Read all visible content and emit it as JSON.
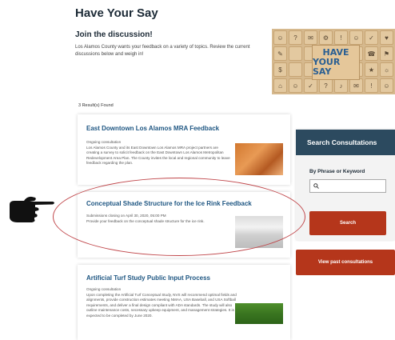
{
  "page": {
    "title": "Have Your Say",
    "join_heading": "Join the discussion!",
    "join_text": "Los Alamos County wants your feedback on a variety of topics. Review the current discussions below and weigh in!"
  },
  "hero": {
    "badge_line1": "HAVE",
    "badge_line2": "YOUR SAY"
  },
  "results": {
    "count_text": "3 Result(s) Found"
  },
  "cards": [
    {
      "title": "East Downtown Los Alamos MRA Feedback",
      "status": "Ongoing consultation",
      "description": "Los Alamos County and its East Downtown Los Alamos MRA project partners are creating a survey to solicit feedback on the East Downtown Los Alamos Metropolitan Redevelopment Area Plan. The County invites the local and regional community to leave feedback regarding the plan."
    },
    {
      "title": "Conceptual Shade Structure for the Ice Rink Feedback",
      "status": "Submissions closing on April 30, 2020, 05:00 PM",
      "description": "Provide your feedback on the conceptual shade structure for the ice rink."
    },
    {
      "title": "Artificial Turf Study Public Input Process",
      "status": "Ongoing consultation",
      "description": "Upon completing the Artificial Turf Conceptual Study, NVS will recommend optimal fields and alignments, provide construction estimates meeting NMAA, USA Baseball, and USA Softball requirements, and deliver a final design compliant with ADA standards. The study will also outline maintenance costs, necessary upkeep equipment, and management strategies. It is expected to be completed by June 2020."
    }
  ],
  "sidebar": {
    "header": "Search Consultations",
    "phrase_label": "By Phrase or Keyword",
    "search_placeholder": "",
    "search_button": "Search",
    "past_button": "View past consultations"
  },
  "colors": {
    "title_text": "#1c2a36",
    "card_title": "#1e5682",
    "panel_header": "#2c4a5f",
    "button": "#b5361b",
    "highlight": "#c0464a"
  },
  "icons": {
    "hand": "pointing-hand-icon",
    "search": "magnifier-icon"
  }
}
